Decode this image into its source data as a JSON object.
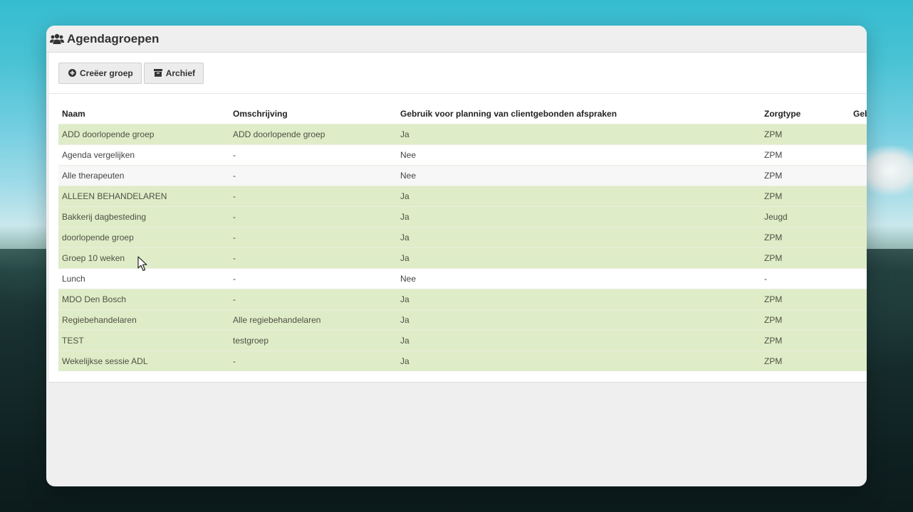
{
  "window": {
    "title": "Agendagroepen",
    "title_icon": "users-icon"
  },
  "toolbar": {
    "create_label": "Creëer groep",
    "create_icon": "plus-circle-icon",
    "archive_label": "Archief",
    "archive_icon": "archive-icon"
  },
  "table": {
    "headers": [
      "Naam",
      "Omschrijving",
      "Gebruik voor planning van clientgebonden afspraken",
      "Zorgtype",
      "Geb"
    ],
    "rows": [
      {
        "naam": "ADD doorlopende groep",
        "omschrijving": "ADD doorlopende groep",
        "gebruik": "Ja",
        "zorgtype": "ZPM",
        "style": "green"
      },
      {
        "naam": "Agenda vergelijken",
        "omschrijving": "-",
        "gebruik": "Nee",
        "zorgtype": "ZPM",
        "style": "white"
      },
      {
        "naam": "Alle therapeuten",
        "omschrijving": "-",
        "gebruik": "Nee",
        "zorgtype": "ZPM",
        "style": "stripe"
      },
      {
        "naam": "ALLEEN BEHANDELAREN",
        "omschrijving": "-",
        "gebruik": "Ja",
        "zorgtype": "ZPM",
        "style": "green"
      },
      {
        "naam": "Bakkerij dagbesteding",
        "omschrijving": "-",
        "gebruik": "Ja",
        "zorgtype": "Jeugd",
        "style": "green"
      },
      {
        "naam": "doorlopende groep",
        "omschrijving": "-",
        "gebruik": "Ja",
        "zorgtype": "ZPM",
        "style": "green"
      },
      {
        "naam": "Groep 10 weken",
        "omschrijving": "-",
        "gebruik": "Ja",
        "zorgtype": "ZPM",
        "style": "green"
      },
      {
        "naam": "Lunch",
        "omschrijving": "-",
        "gebruik": "Nee",
        "zorgtype": "-",
        "style": "white"
      },
      {
        "naam": "MDO Den Bosch",
        "omschrijving": "-",
        "gebruik": "Ja",
        "zorgtype": "ZPM",
        "style": "green"
      },
      {
        "naam": "Regiebehandelaren",
        "omschrijving": "Alle regiebehandelaren",
        "gebruik": "Ja",
        "zorgtype": "ZPM",
        "style": "green"
      },
      {
        "naam": "TEST",
        "omschrijving": "testgroep",
        "gebruik": "Ja",
        "zorgtype": "ZPM",
        "style": "green"
      },
      {
        "naam": "Wekelijkse sessie ADL",
        "omschrijving": "-",
        "gebruik": "Ja",
        "zorgtype": "ZPM",
        "style": "green"
      }
    ]
  },
  "colors": {
    "active_row": "#dfecc8",
    "window_bg": "#efefef",
    "panel_bg": "#ffffff"
  }
}
